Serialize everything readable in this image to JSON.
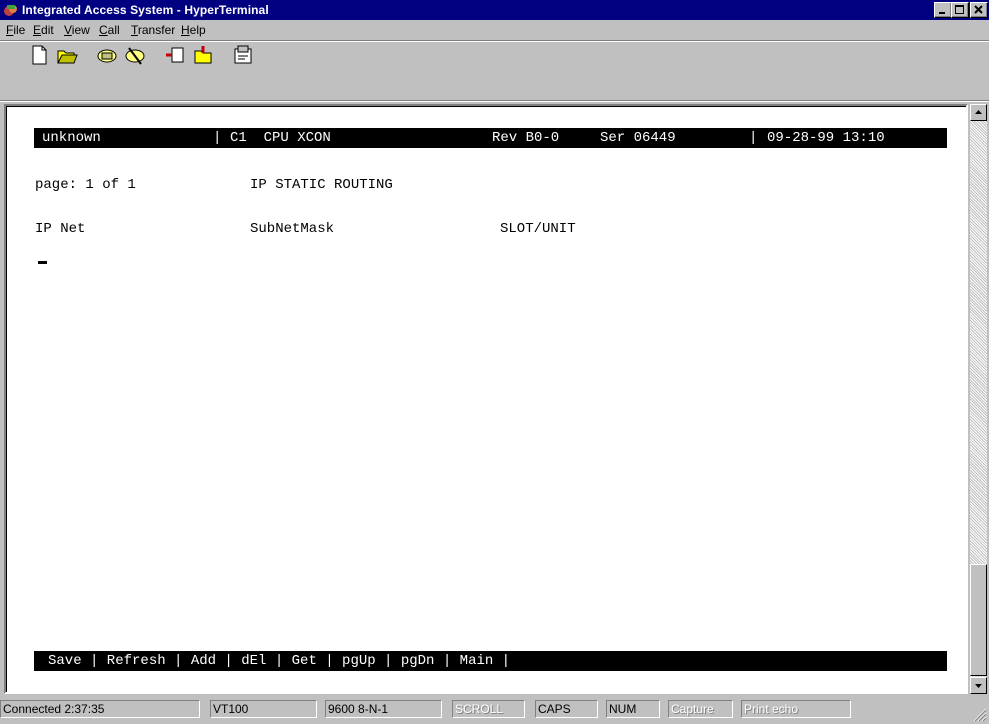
{
  "window": {
    "title": "Integrated Access System - HyperTerminal"
  },
  "menu": {
    "items": [
      {
        "key": "F",
        "rest": "ile"
      },
      {
        "key": "E",
        "rest": "dit"
      },
      {
        "key": "V",
        "rest": "iew"
      },
      {
        "key": "C",
        "rest": "all"
      },
      {
        "key": "T",
        "rest": "ransfer"
      },
      {
        "key": "H",
        "rest": "elp"
      }
    ]
  },
  "toolbar": {
    "icons": [
      "new-icon",
      "open-icon",
      "connect-icon",
      "disconnect-icon",
      "send-icon",
      "receive-icon",
      "properties-icon"
    ]
  },
  "terminal": {
    "header": {
      "name": "unknown",
      "sep1": "|",
      "module": "C1  CPU XCON",
      "rev": "Rev B0-0",
      "ser": "Ser 06449",
      "sep2": "|",
      "datetime": "09-28-99 13:10"
    },
    "page_label": "page: 1 of 1",
    "screen_title": "IP STATIC ROUTING",
    "columns": [
      "IP Net",
      "SubNetMask",
      "SLOT/UNIT"
    ],
    "footer": "Save | Refresh | Add | dEl | Get | pgUp | pgDn | Main |"
  },
  "statusbar": {
    "connected": "Connected 2:37:35",
    "emulation": "VT100",
    "settings": "9600 8-N-1",
    "scroll": "SCROLL",
    "caps": "CAPS",
    "num": "NUM",
    "capture": "Capture",
    "print_echo": "Print echo"
  },
  "colors": {
    "titlebar": "#000080",
    "window": "#c0c0c0",
    "terminal_bg": "#ffffff",
    "terminal_bar": "#000000"
  }
}
